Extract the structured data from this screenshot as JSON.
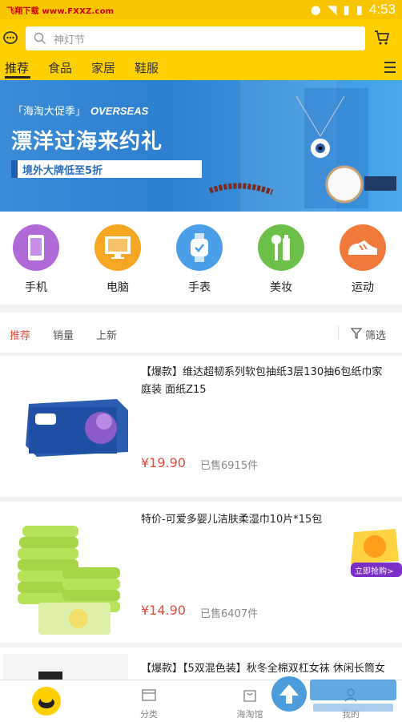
{
  "statusbar": {
    "watermark": "飞翔下载 www.FXXZ.com",
    "time": "4:53"
  },
  "search": {
    "placeholder": "神灯节"
  },
  "categories": [
    "推荐",
    "食品",
    "家居",
    "鞋服"
  ],
  "banner": {
    "tag": "「海淘大促季」",
    "tag_en": "OVERSEAS",
    "title": "漂洋过海来约礼",
    "subtitle": "境外大牌低至5折"
  },
  "icons": [
    {
      "label": "手机",
      "icon": "phone-icon",
      "color": "#b06ad8"
    },
    {
      "label": "电脑",
      "icon": "monitor-icon",
      "color": "#f5a623"
    },
    {
      "label": "手表",
      "icon": "watch-icon",
      "color": "#4a9fe8"
    },
    {
      "label": "美妆",
      "icon": "cosmetics-icon",
      "color": "#6cc04a"
    },
    {
      "label": "运动",
      "icon": "sneaker-icon",
      "color": "#f07a3a"
    }
  ],
  "filters": {
    "items": [
      "推荐",
      "销量",
      "上新"
    ],
    "screen": "筛选"
  },
  "products": [
    {
      "title": "【爆款】维达超韧系列软包抽纸3层130抽6包纸巾家庭装 面纸Z15",
      "price": "¥19.90",
      "sold": "已售6915件"
    },
    {
      "title": "特价-可爱多婴儿洁肤柔湿巾10片*15包",
      "price": "¥14.90",
      "sold": "已售6407件",
      "badge": "立即抢购>"
    },
    {
      "title": "【爆款】【5双混色装】秋冬全棉双杠女袜 休闲长筒女袜"
    }
  ],
  "tabbar": [
    {
      "label": ""
    },
    {
      "label": "分类"
    },
    {
      "label": "海淘馆"
    },
    {
      "label": "我的"
    }
  ],
  "colors": {
    "brand": "#ffd000",
    "accent": "#e24b3d"
  }
}
